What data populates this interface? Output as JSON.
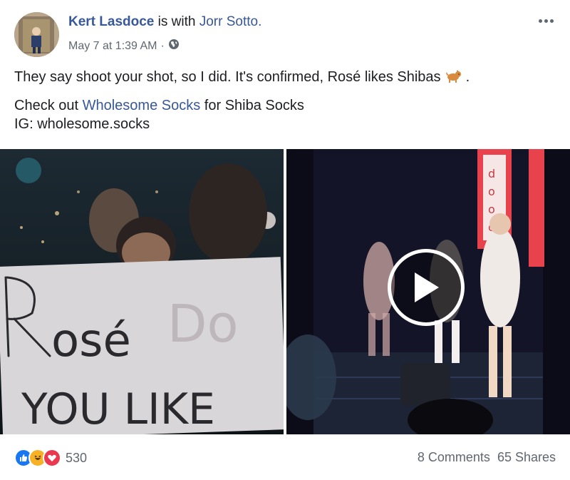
{
  "post": {
    "author": "Kert Lasdoce",
    "with_text": "is with",
    "tagged": "Jorr Sotto.",
    "timestamp": "May 7 at 1:39 AM",
    "separator": "·",
    "privacy_icon": "globe-icon",
    "text_line1": "They say shoot your shot, so I did. It's confirmed, Rosé likes Shibas",
    "text_emoji": "🐕",
    "text_period": ".",
    "text_line2_pre": "Check out ",
    "text_line2_link": "Wholesome Socks",
    "text_line2_post": " for Shiba Socks",
    "text_line3": "IG: wholesome.socks"
  },
  "media": {
    "sign_line1": "Rosé Do",
    "sign_line2": "YOU LIKE",
    "banner_text": "D d o o o o"
  },
  "footer": {
    "reaction_icons": [
      "like-icon",
      "haha-icon",
      "love-icon"
    ],
    "reaction_count": "530",
    "comments": "8 Comments",
    "shares": "65 Shares"
  },
  "colors": {
    "link": "#385898",
    "meta": "#606770",
    "like": "#1877f2",
    "haha": "#f7b125",
    "love": "#e9384f"
  }
}
